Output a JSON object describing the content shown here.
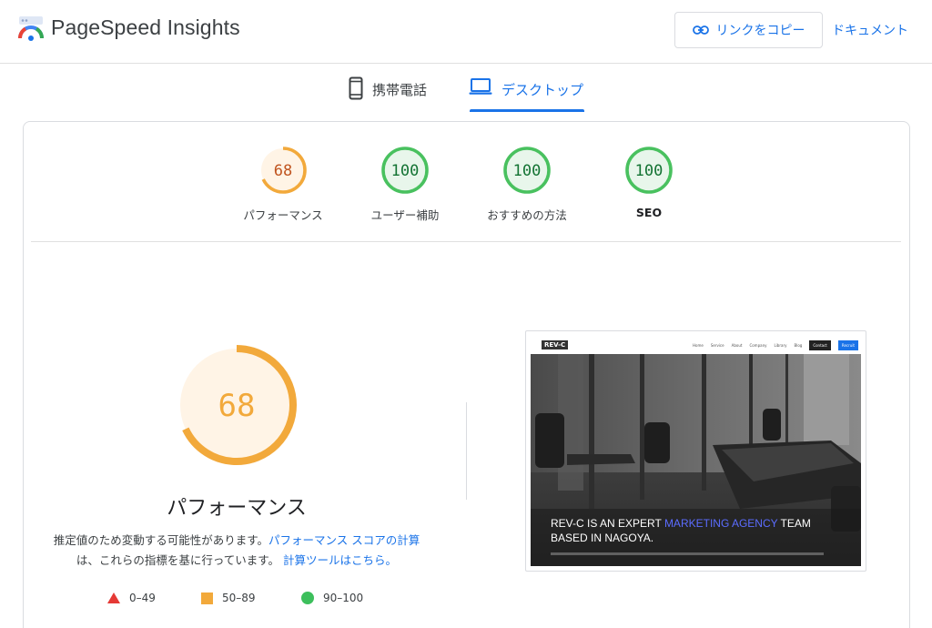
{
  "header": {
    "app_title": "PageSpeed Insights",
    "copy_link_label": "リンクをコピー",
    "docs_label": "ドキュメント"
  },
  "tabs": [
    {
      "label": "携帯電話",
      "icon": "smartphone-icon",
      "selected": false
    },
    {
      "label": "デスクトップ",
      "icon": "laptop-icon",
      "selected": true
    }
  ],
  "gauges": [
    {
      "label": "パフォーマンス",
      "score": 68,
      "status": "average"
    },
    {
      "label": "ユーザー補助",
      "score": 100,
      "status": "pass"
    },
    {
      "label": "おすすめの方法",
      "score": 100,
      "status": "pass"
    },
    {
      "label": "SEO",
      "score": 100,
      "status": "pass"
    }
  ],
  "performance": {
    "score": 68,
    "title": "パフォーマンス",
    "note_prefix": "推定値のため変動する可能性があります。",
    "note_link1": "パフォーマンス スコアの計算",
    "note_middle": "は、これらの指標を基に行っています。",
    "note_link2": "計算ツールはこちら。"
  },
  "legend": [
    {
      "range": "0–49",
      "shape": "triangle",
      "color": "#e53935"
    },
    {
      "range": "50–89",
      "shape": "square",
      "color": "#f2a93b"
    },
    {
      "range": "90–100",
      "shape": "circle",
      "color": "#3dbf5c"
    }
  ],
  "colors": {
    "accent": "#1a73e8",
    "average": "#f2a93b",
    "average_text": "#c0541f",
    "average_bg": "#fff4e6",
    "pass": "#49c15f",
    "pass_text": "#137333",
    "pass_bg": "#e8f6eb"
  },
  "thumbnail": {
    "brand": "REV-C",
    "nav": [
      "Home",
      "Service",
      "About",
      "Company",
      "Library",
      "Blog",
      "Contact",
      "Recruit"
    ],
    "headline_line1_a": "REV-C IS AN EXPERT ",
    "headline_line1_b": "MARKETING AGENCY",
    "headline_line1_c": " TEAM",
    "headline_line2": "BASED IN NAGOYA."
  }
}
